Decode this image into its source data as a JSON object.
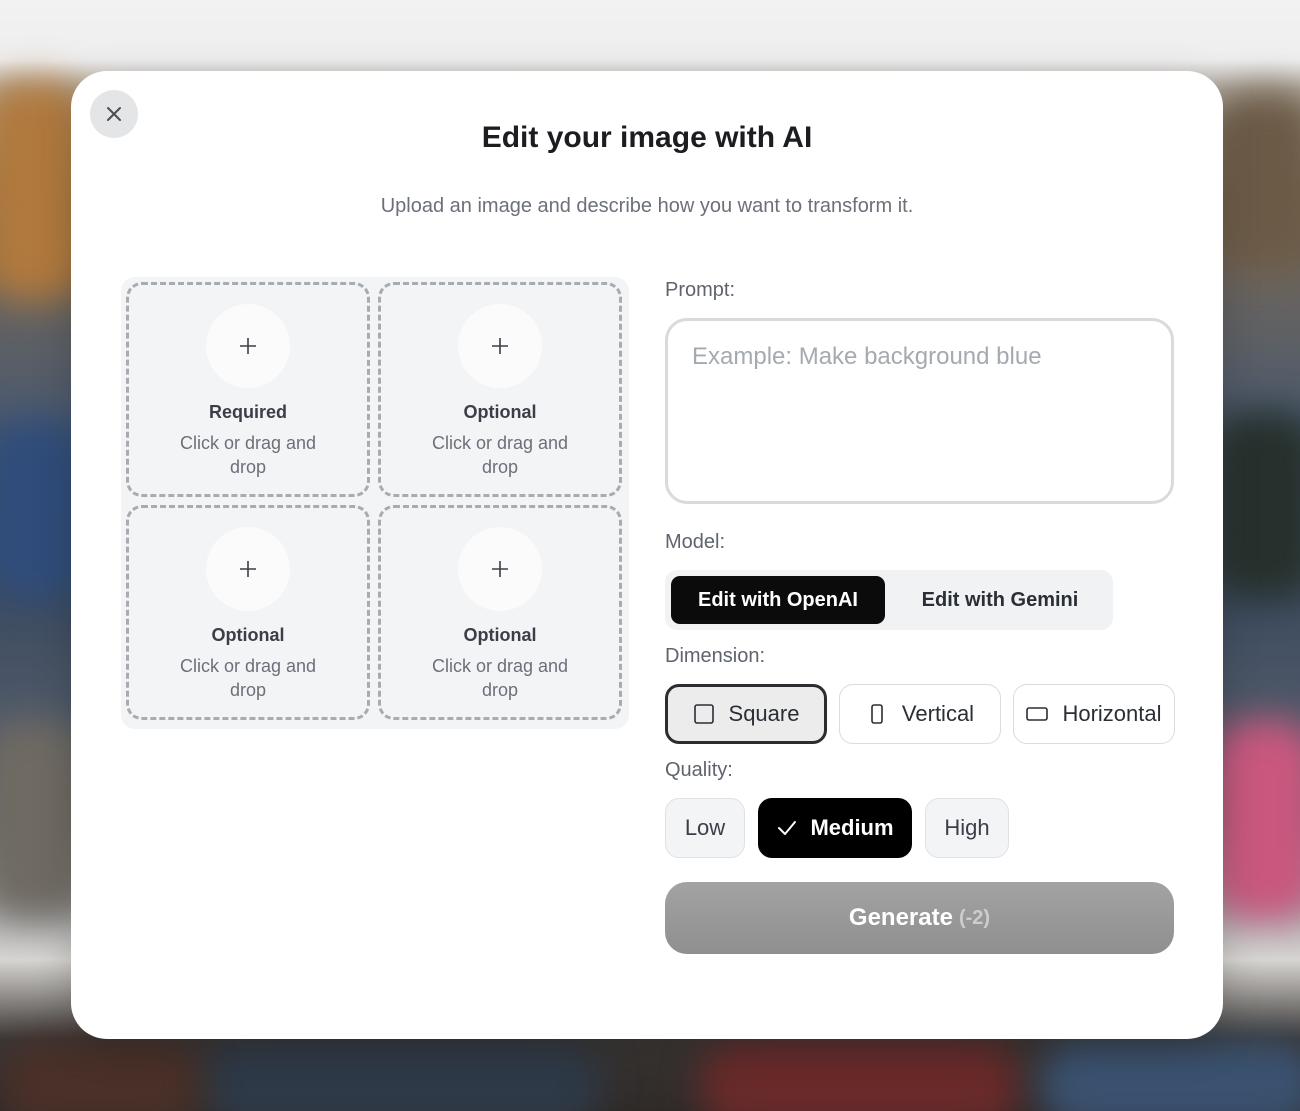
{
  "dialog": {
    "title": "Edit your image with AI",
    "subtitle": "Upload an image and describe how you want to transform it."
  },
  "uploads": [
    {
      "label": "Required",
      "hint": "Click or drag and drop"
    },
    {
      "label": "Optional",
      "hint": "Click or drag and drop"
    },
    {
      "label": "Optional",
      "hint": "Click or drag and drop"
    },
    {
      "label": "Optional",
      "hint": "Click or drag and drop"
    }
  ],
  "prompt": {
    "label": "Prompt:",
    "placeholder": "Example: Make background blue",
    "value": ""
  },
  "model": {
    "label": "Model:",
    "options": [
      "Edit with OpenAI",
      "Edit with Gemini"
    ],
    "selected": "Edit with OpenAI"
  },
  "dimension": {
    "label": "Dimension:",
    "options": [
      {
        "label": "Square",
        "icon": "square-icon"
      },
      {
        "label": "Vertical",
        "icon": "portrait-rect-icon"
      },
      {
        "label": "Horizontal",
        "icon": "landscape-rect-icon"
      }
    ],
    "selected": "Square"
  },
  "quality": {
    "label": "Quality:",
    "options": [
      "Low",
      "Medium",
      "High"
    ],
    "selected": "Medium"
  },
  "generate": {
    "label": "Generate",
    "cost": "(-2)"
  },
  "icons": {
    "close": "close-icon",
    "plus": "plus-icon",
    "check": "check-icon"
  }
}
